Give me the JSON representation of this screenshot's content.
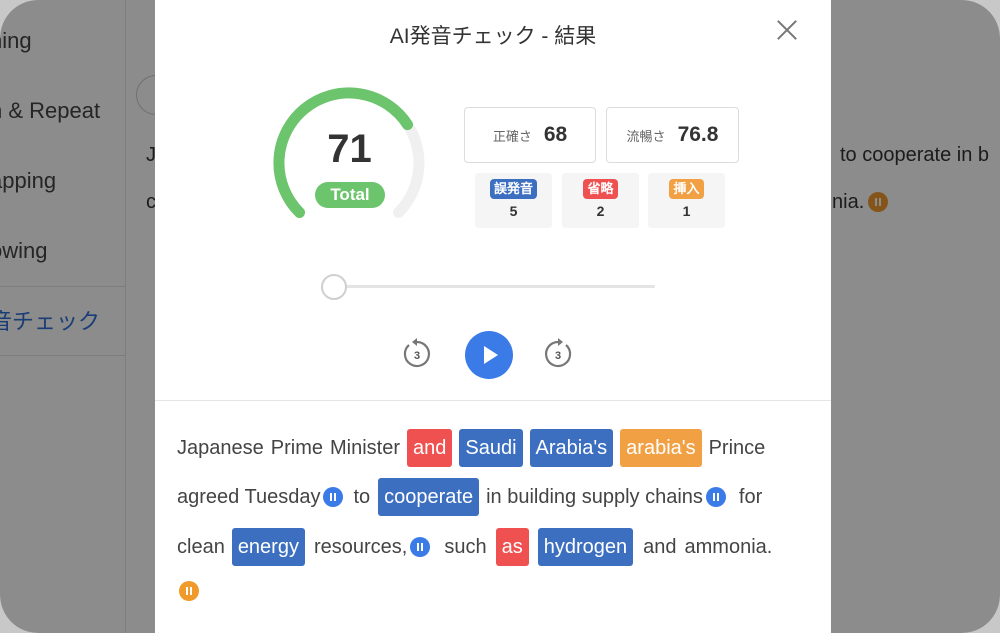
{
  "background": {
    "sidebar_items": [
      {
        "label": "ning"
      },
      {
        "label": "n & Repeat"
      },
      {
        "label": "apping"
      },
      {
        "label": "owing"
      },
      {
        "label": "音チェック"
      }
    ],
    "text_line1_fragment": "J",
    "text_line1_right": "to cooperate in b",
    "text_line2_fragment": "c",
    "text_line2_right": "nia."
  },
  "modal": {
    "title": "AI発音チェック - 結果",
    "total": {
      "score": "71",
      "label": "Total",
      "fraction": 0.71
    },
    "stats": [
      {
        "label": "正確さ",
        "value": "68"
      },
      {
        "label": "流暢さ",
        "value": "76.8"
      }
    ],
    "errors": [
      {
        "label": "誤発音",
        "count": "5",
        "color": "#3d6fc1"
      },
      {
        "label": "省略",
        "count": "2",
        "color": "#ef5050"
      },
      {
        "label": "挿入",
        "count": "1",
        "color": "#f1a044"
      }
    ],
    "controls": {
      "rewind_seconds": "3",
      "forward_seconds": "3"
    },
    "transcript": {
      "line1": [
        "Japanese",
        "Prime",
        "Minister",
        "and",
        "Saudi",
        "Arabia's",
        "arabia's",
        "Prince"
      ],
      "line2": [
        "agreed Tuesday",
        "to",
        "cooperate",
        "in building supply chains",
        "for"
      ],
      "line3": [
        "clean",
        "energy",
        "resources,",
        "such",
        "as",
        "hydrogen",
        "and",
        "ammonia."
      ]
    }
  },
  "colors": {
    "accent": "#3a7be8",
    "total_green": "#6cc46c",
    "misread": "#3d6fc1",
    "omission": "#ef5050",
    "insertion": "#f1a044"
  }
}
